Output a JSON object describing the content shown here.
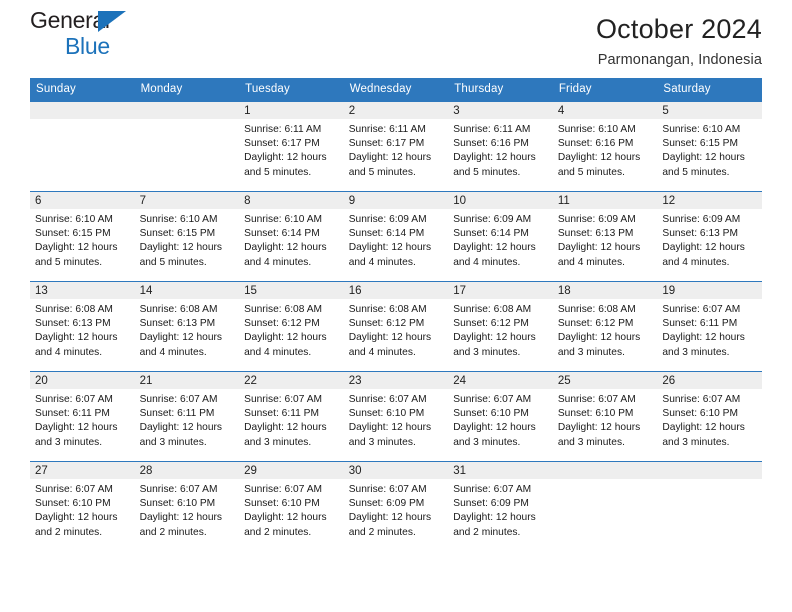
{
  "brand": {
    "name_part1": "General",
    "name_part2": "Blue",
    "logo_icon": "triangle-icon",
    "accent_color": "#1c72ba"
  },
  "header": {
    "title": "October 2024",
    "subtitle": "Parmonangan, Indonesia"
  },
  "theme": {
    "header_blue": "#2e78bd",
    "band_gray": "#eeeeee",
    "text": "#1a1a1a"
  },
  "weekdays": [
    "Sunday",
    "Monday",
    "Tuesday",
    "Wednesday",
    "Thursday",
    "Friday",
    "Saturday"
  ],
  "labels": {
    "sunrise_prefix": "Sunrise:",
    "sunset_prefix": "Sunset:",
    "daylight_prefix": "Daylight:"
  },
  "weeks": [
    [
      {
        "day": "",
        "empty": true
      },
      {
        "day": "",
        "empty": true
      },
      {
        "day": "1",
        "sunrise": "Sunrise: 6:11 AM",
        "sunset": "Sunset: 6:17 PM",
        "daylight_line1": "Daylight: 12 hours",
        "daylight_line2": "and 5 minutes."
      },
      {
        "day": "2",
        "sunrise": "Sunrise: 6:11 AM",
        "sunset": "Sunset: 6:17 PM",
        "daylight_line1": "Daylight: 12 hours",
        "daylight_line2": "and 5 minutes."
      },
      {
        "day": "3",
        "sunrise": "Sunrise: 6:11 AM",
        "sunset": "Sunset: 6:16 PM",
        "daylight_line1": "Daylight: 12 hours",
        "daylight_line2": "and 5 minutes."
      },
      {
        "day": "4",
        "sunrise": "Sunrise: 6:10 AM",
        "sunset": "Sunset: 6:16 PM",
        "daylight_line1": "Daylight: 12 hours",
        "daylight_line2": "and 5 minutes."
      },
      {
        "day": "5",
        "sunrise": "Sunrise: 6:10 AM",
        "sunset": "Sunset: 6:15 PM",
        "daylight_line1": "Daylight: 12 hours",
        "daylight_line2": "and 5 minutes."
      }
    ],
    [
      {
        "day": "6",
        "sunrise": "Sunrise: 6:10 AM",
        "sunset": "Sunset: 6:15 PM",
        "daylight_line1": "Daylight: 12 hours",
        "daylight_line2": "and 5 minutes."
      },
      {
        "day": "7",
        "sunrise": "Sunrise: 6:10 AM",
        "sunset": "Sunset: 6:15 PM",
        "daylight_line1": "Daylight: 12 hours",
        "daylight_line2": "and 5 minutes."
      },
      {
        "day": "8",
        "sunrise": "Sunrise: 6:10 AM",
        "sunset": "Sunset: 6:14 PM",
        "daylight_line1": "Daylight: 12 hours",
        "daylight_line2": "and 4 minutes."
      },
      {
        "day": "9",
        "sunrise": "Sunrise: 6:09 AM",
        "sunset": "Sunset: 6:14 PM",
        "daylight_line1": "Daylight: 12 hours",
        "daylight_line2": "and 4 minutes."
      },
      {
        "day": "10",
        "sunrise": "Sunrise: 6:09 AM",
        "sunset": "Sunset: 6:14 PM",
        "daylight_line1": "Daylight: 12 hours",
        "daylight_line2": "and 4 minutes."
      },
      {
        "day": "11",
        "sunrise": "Sunrise: 6:09 AM",
        "sunset": "Sunset: 6:13 PM",
        "daylight_line1": "Daylight: 12 hours",
        "daylight_line2": "and 4 minutes."
      },
      {
        "day": "12",
        "sunrise": "Sunrise: 6:09 AM",
        "sunset": "Sunset: 6:13 PM",
        "daylight_line1": "Daylight: 12 hours",
        "daylight_line2": "and 4 minutes."
      }
    ],
    [
      {
        "day": "13",
        "sunrise": "Sunrise: 6:08 AM",
        "sunset": "Sunset: 6:13 PM",
        "daylight_line1": "Daylight: 12 hours",
        "daylight_line2": "and 4 minutes."
      },
      {
        "day": "14",
        "sunrise": "Sunrise: 6:08 AM",
        "sunset": "Sunset: 6:13 PM",
        "daylight_line1": "Daylight: 12 hours",
        "daylight_line2": "and 4 minutes."
      },
      {
        "day": "15",
        "sunrise": "Sunrise: 6:08 AM",
        "sunset": "Sunset: 6:12 PM",
        "daylight_line1": "Daylight: 12 hours",
        "daylight_line2": "and 4 minutes."
      },
      {
        "day": "16",
        "sunrise": "Sunrise: 6:08 AM",
        "sunset": "Sunset: 6:12 PM",
        "daylight_line1": "Daylight: 12 hours",
        "daylight_line2": "and 4 minutes."
      },
      {
        "day": "17",
        "sunrise": "Sunrise: 6:08 AM",
        "sunset": "Sunset: 6:12 PM",
        "daylight_line1": "Daylight: 12 hours",
        "daylight_line2": "and 3 minutes."
      },
      {
        "day": "18",
        "sunrise": "Sunrise: 6:08 AM",
        "sunset": "Sunset: 6:12 PM",
        "daylight_line1": "Daylight: 12 hours",
        "daylight_line2": "and 3 minutes."
      },
      {
        "day": "19",
        "sunrise": "Sunrise: 6:07 AM",
        "sunset": "Sunset: 6:11 PM",
        "daylight_line1": "Daylight: 12 hours",
        "daylight_line2": "and 3 minutes."
      }
    ],
    [
      {
        "day": "20",
        "sunrise": "Sunrise: 6:07 AM",
        "sunset": "Sunset: 6:11 PM",
        "daylight_line1": "Daylight: 12 hours",
        "daylight_line2": "and 3 minutes."
      },
      {
        "day": "21",
        "sunrise": "Sunrise: 6:07 AM",
        "sunset": "Sunset: 6:11 PM",
        "daylight_line1": "Daylight: 12 hours",
        "daylight_line2": "and 3 minutes."
      },
      {
        "day": "22",
        "sunrise": "Sunrise: 6:07 AM",
        "sunset": "Sunset: 6:11 PM",
        "daylight_line1": "Daylight: 12 hours",
        "daylight_line2": "and 3 minutes."
      },
      {
        "day": "23",
        "sunrise": "Sunrise: 6:07 AM",
        "sunset": "Sunset: 6:10 PM",
        "daylight_line1": "Daylight: 12 hours",
        "daylight_line2": "and 3 minutes."
      },
      {
        "day": "24",
        "sunrise": "Sunrise: 6:07 AM",
        "sunset": "Sunset: 6:10 PM",
        "daylight_line1": "Daylight: 12 hours",
        "daylight_line2": "and 3 minutes."
      },
      {
        "day": "25",
        "sunrise": "Sunrise: 6:07 AM",
        "sunset": "Sunset: 6:10 PM",
        "daylight_line1": "Daylight: 12 hours",
        "daylight_line2": "and 3 minutes."
      },
      {
        "day": "26",
        "sunrise": "Sunrise: 6:07 AM",
        "sunset": "Sunset: 6:10 PM",
        "daylight_line1": "Daylight: 12 hours",
        "daylight_line2": "and 3 minutes."
      }
    ],
    [
      {
        "day": "27",
        "sunrise": "Sunrise: 6:07 AM",
        "sunset": "Sunset: 6:10 PM",
        "daylight_line1": "Daylight: 12 hours",
        "daylight_line2": "and 2 minutes."
      },
      {
        "day": "28",
        "sunrise": "Sunrise: 6:07 AM",
        "sunset": "Sunset: 6:10 PM",
        "daylight_line1": "Daylight: 12 hours",
        "daylight_line2": "and 2 minutes."
      },
      {
        "day": "29",
        "sunrise": "Sunrise: 6:07 AM",
        "sunset": "Sunset: 6:10 PM",
        "daylight_line1": "Daylight: 12 hours",
        "daylight_line2": "and 2 minutes."
      },
      {
        "day": "30",
        "sunrise": "Sunrise: 6:07 AM",
        "sunset": "Sunset: 6:09 PM",
        "daylight_line1": "Daylight: 12 hours",
        "daylight_line2": "and 2 minutes."
      },
      {
        "day": "31",
        "sunrise": "Sunrise: 6:07 AM",
        "sunset": "Sunset: 6:09 PM",
        "daylight_line1": "Daylight: 12 hours",
        "daylight_line2": "and 2 minutes."
      },
      {
        "day": "",
        "empty": true
      },
      {
        "day": "",
        "empty": true
      }
    ]
  ]
}
